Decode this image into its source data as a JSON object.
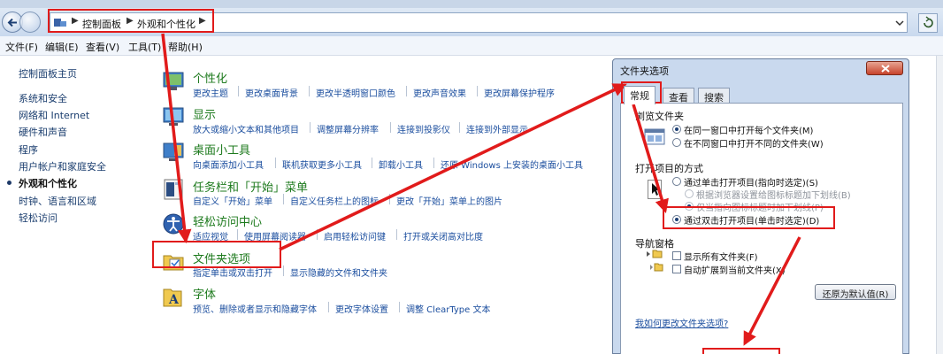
{
  "address_bar": {
    "crumbs": [
      "控制面板",
      "外观和个性化"
    ]
  },
  "menu": {
    "items": [
      "文件(F)",
      "编辑(E)",
      "查看(V)",
      "工具(T)",
      "帮助(H)"
    ]
  },
  "left_nav": {
    "items": [
      "控制面板主页",
      "系统和安全",
      "网络和 Internet",
      "硬件和声音",
      "程序",
      "用户帐户和家庭安全",
      "外观和个性化",
      "时钟、语言和区域",
      "轻松访问"
    ],
    "active_index": 6
  },
  "categories": [
    {
      "title": "个性化",
      "links": [
        "更改主题",
        "更改桌面背景",
        "更改半透明窗口颜色",
        "更改声音效果",
        "更改屏幕保护程序"
      ]
    },
    {
      "title": "显示",
      "links": [
        "放大或缩小文本和其他项目",
        "调整屏幕分辨率",
        "连接到投影仪",
        "连接到外部显示"
      ]
    },
    {
      "title": "桌面小工具",
      "links": [
        "向桌面添加小工具",
        "联机获取更多小工具",
        "卸载小工具",
        "还原 Windows 上安装的桌面小工具"
      ]
    },
    {
      "title": "任务栏和「开始」菜单",
      "links": [
        "自定义「开始」菜单",
        "自定义任务栏上的图标",
        "更改「开始」菜单上的图片"
      ]
    },
    {
      "title": "轻松访问中心",
      "links": [
        "适应视觉",
        "使用屏幕阅读器",
        "启用轻松访问键",
        "打开或关闭高对比度"
      ]
    },
    {
      "title": "文件夹选项",
      "links": [
        "指定单击或双击打开",
        "显示隐藏的文件和文件夹"
      ]
    },
    {
      "title": "字体",
      "links": [
        "预览、删除或者显示和隐藏字体",
        "更改字体设置",
        "调整 ClearType 文本"
      ]
    }
  ],
  "dialog": {
    "title": "文件夹选项",
    "tabs": [
      "常规",
      "查看",
      "搜索"
    ],
    "active_tab": 0,
    "browse_group": {
      "label": "浏览文件夹",
      "options": [
        "在同一窗口中打开每个文件夹(M)",
        "在不同窗口中打开不同的文件夹(W)"
      ],
      "selected": 0
    },
    "click_group": {
      "label": "打开项目的方式",
      "options": [
        "通过单击打开项目(指向时选定)(S)",
        "根据浏览器设置给图标标题加下划线(B)",
        "仅当指向图标标题时加下划线(P)",
        "通过双击打开项目(单击时选定)(D)"
      ],
      "selected": 3
    },
    "nav_group": {
      "label": "导航窗格",
      "checks": [
        "显示所有文件夹(F)",
        "自动扩展到当前文件夹(X)"
      ]
    },
    "restore_button": "还原为默认值(R)",
    "help_link": "我如何更改文件夹选项?"
  },
  "colors": {
    "category_title": "#1d7a1d",
    "link": "#1a4d9e",
    "annotation": "#e11b1b"
  }
}
